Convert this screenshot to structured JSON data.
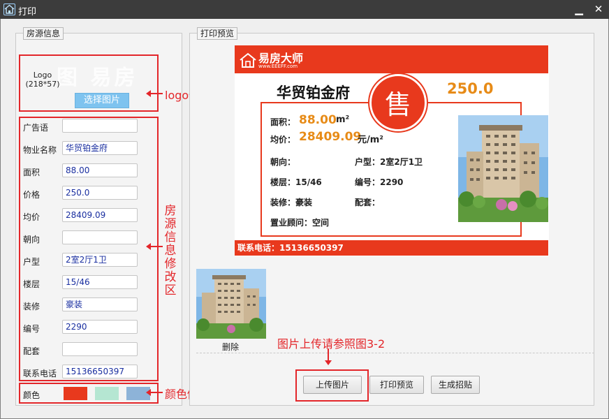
{
  "window": {
    "title": "打印"
  },
  "left_panel": {
    "title": "房源信息",
    "logo": {
      "label": "Logo",
      "size": "(218*57)",
      "watermark": "图 易房",
      "select_button": "选择图片"
    },
    "fields": [
      {
        "label": "广告语",
        "value": ""
      },
      {
        "label": "物业名称",
        "value": "华贸铂金府"
      },
      {
        "label": "面积",
        "value": "88.00"
      },
      {
        "label": "价格",
        "value": "250.0"
      },
      {
        "label": "均价",
        "value": "28409.09"
      },
      {
        "label": "朝向",
        "value": ""
      },
      {
        "label": "户型",
        "value": "2室2厅1卫"
      },
      {
        "label": "楼层",
        "value": "15/46"
      },
      {
        "label": "装修",
        "value": "豪装"
      },
      {
        "label": "编号",
        "value": "2290"
      },
      {
        "label": "配套",
        "value": ""
      },
      {
        "label": "联系电话",
        "value": "15136650397"
      }
    ],
    "color": {
      "label": "颜色",
      "swatches": [
        "#e8391d",
        "#b5e6d2",
        "#8db3d8"
      ]
    }
  },
  "right_panel": {
    "title": "打印预览",
    "poster": {
      "brand_name": "易房大师",
      "brand_url": "www.EEEFF.com",
      "property_name": "华贸铂金府",
      "sale_char": "售",
      "price": "250.0",
      "area_label": "面积：",
      "area_value": "88.00",
      "area_unit": "m²",
      "avg_label": "均价：",
      "avg_value": "28409.09",
      "avg_unit": "元/m²",
      "orientation": "朝向：",
      "layout": "户型：2室2厅1卫",
      "floor": "楼层：15/46",
      "code": "编号：2290",
      "decoration": "装修：豪装",
      "facilities": "配套：",
      "agent": "置业顾问：空间",
      "contact": "联系电话：15136650397"
    },
    "thumbnail": {
      "delete_label": "删除"
    }
  },
  "buttons": {
    "upload": "上传图片",
    "print_preview": "打印预览",
    "generate": "生成招贴"
  },
  "annotations": {
    "logo_area": "logo修改区",
    "info_area": "房源信息修改区",
    "color_area": "颜色修改区",
    "upload_note": "图片上传请参照图3-2"
  },
  "colors": {
    "accent_red": "#e8391d",
    "price_orange": "#e78b17",
    "annotation_red": "#e3262a"
  }
}
